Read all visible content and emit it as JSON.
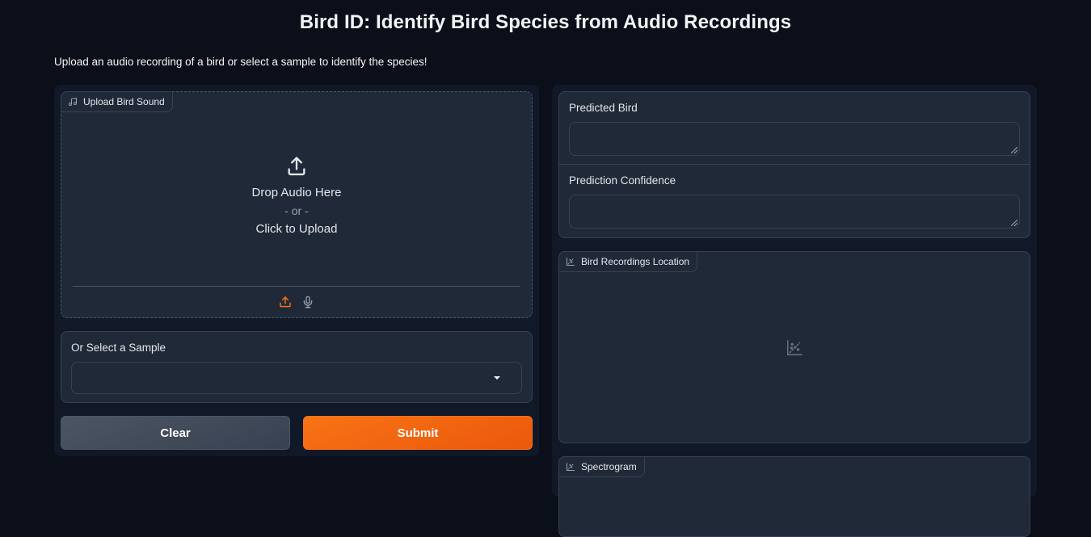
{
  "header": {
    "title": "Bird ID: Identify Bird Species from Audio Recordings",
    "subtitle": "Upload an audio recording of a bird or select a sample to identify the species!"
  },
  "upload": {
    "label": "Upload Bird Sound",
    "label_icon": "music-note-icon",
    "drop_text": "Drop Audio Here",
    "or_text": "- or -",
    "click_text": "Click to Upload",
    "sources": [
      {
        "name": "upload",
        "icon": "upload-icon",
        "active": true
      },
      {
        "name": "microphone",
        "icon": "microphone-icon",
        "active": false
      }
    ]
  },
  "sample": {
    "label": "Or Select a Sample",
    "selected": ""
  },
  "buttons": {
    "clear": "Clear",
    "submit": "Submit"
  },
  "outputs": {
    "predicted_bird": {
      "label": "Predicted Bird",
      "value": ""
    },
    "confidence": {
      "label": "Prediction Confidence",
      "value": ""
    }
  },
  "plots": {
    "location": {
      "label": "Bird Recordings Location",
      "icon": "scatter-plot-icon"
    },
    "spectrogram": {
      "label": "Spectrogram",
      "icon": "scatter-plot-icon"
    }
  },
  "colors": {
    "accent": "#f97316",
    "background": "#0b0f19",
    "panel": "#111827",
    "block": "#1f2937",
    "border": "#374151"
  }
}
